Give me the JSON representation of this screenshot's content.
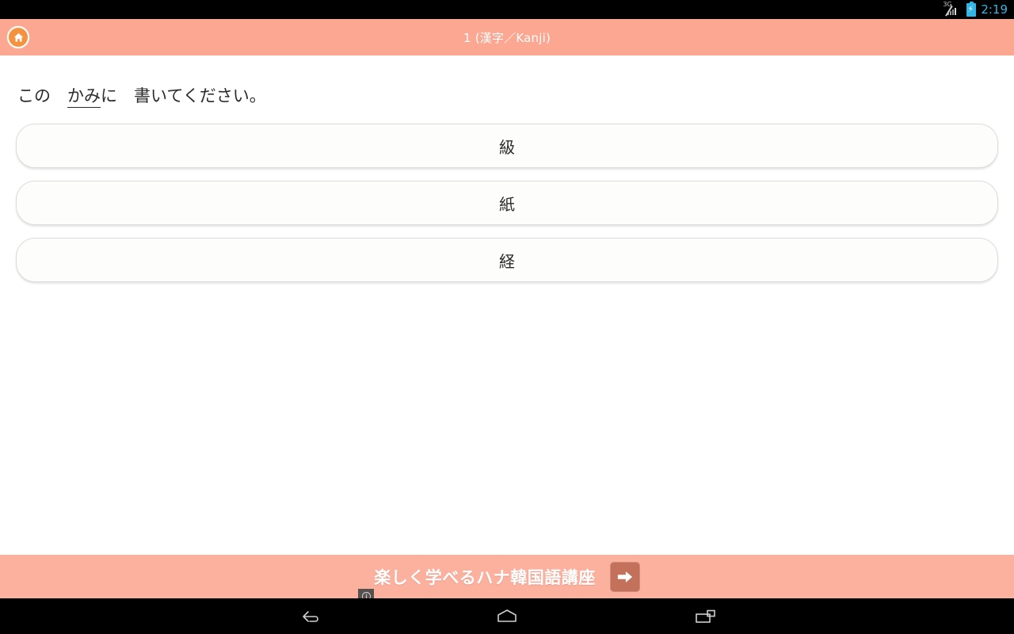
{
  "statusbar": {
    "network_label": "3G",
    "network_icon": "signal-bars-icon",
    "battery_icon": "battery-charging-icon",
    "time": "2:19"
  },
  "actionbar": {
    "home_icon": "home-icon",
    "title": "1 (漢字／Kanji)",
    "background_color": "#fca792"
  },
  "question": {
    "prefix": "この　",
    "underlined": "かみ",
    "suffix": "に　書いてください。"
  },
  "choices": [
    {
      "label": "級"
    },
    {
      "label": "紙"
    },
    {
      "label": "経"
    }
  ],
  "ad": {
    "text": "楽しく学べるハナ韓国語講座",
    "cta_icon": "arrow-right-icon",
    "info_icon": "info-circle-icon",
    "background_color": "#fcb09e",
    "cta_color": "#c4715c"
  },
  "navbar": {
    "back_icon": "back-arrow-icon",
    "home_icon": "home-pentagon-icon",
    "recents_icon": "recent-apps-icon"
  }
}
